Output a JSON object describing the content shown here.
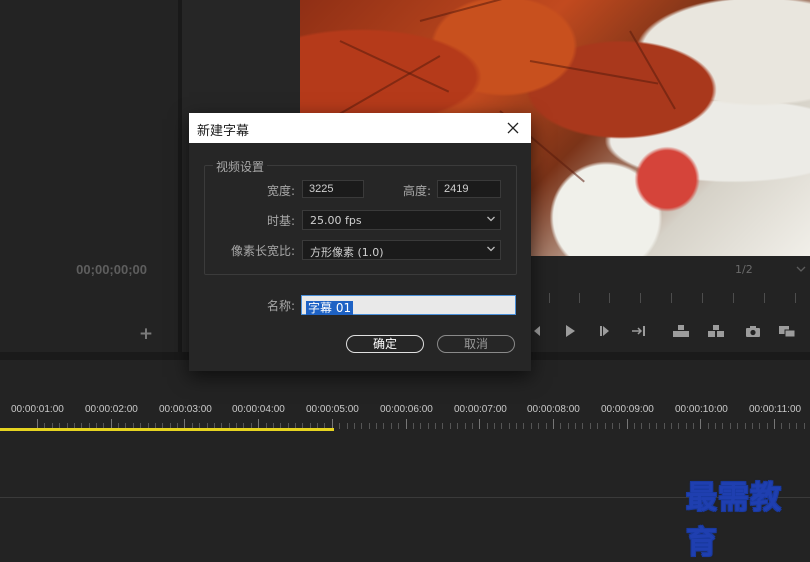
{
  "left_panel": {
    "timecode": "00;00;00;00",
    "add_symbol": "+"
  },
  "program_monitor": {
    "page_select": "1/2"
  },
  "timeline": {
    "labels": [
      "00:00:01:00",
      "00:00:02:00",
      "00:00:03:00",
      "00:00:04:00",
      "00:00:05:00",
      "00:00:06:00",
      "00:00:07:00",
      "00:00:08:00",
      "00:00:09:00",
      "00:00:10:00",
      "00:00:11:00"
    ],
    "work_area_color": "#e5d320"
  },
  "dialog": {
    "title": "新建字幕",
    "group_label": "视频设置",
    "width_label": "宽度:",
    "width_value": "3225",
    "height_label": "高度:",
    "height_value": "2419",
    "timebase_label": "时基:",
    "timebase_value": "25.00 fps",
    "pixel_aspect_label": "像素长宽比:",
    "pixel_aspect_value": "方形像素 (1.0)",
    "name_label": "名称:",
    "name_value": "字幕 01",
    "ok_label": "确定",
    "cancel_label": "取消"
  },
  "watermark": "最需教育",
  "colors": {
    "accent": "#1e62c4",
    "background": "#232323",
    "work_area": "#e5d320"
  }
}
